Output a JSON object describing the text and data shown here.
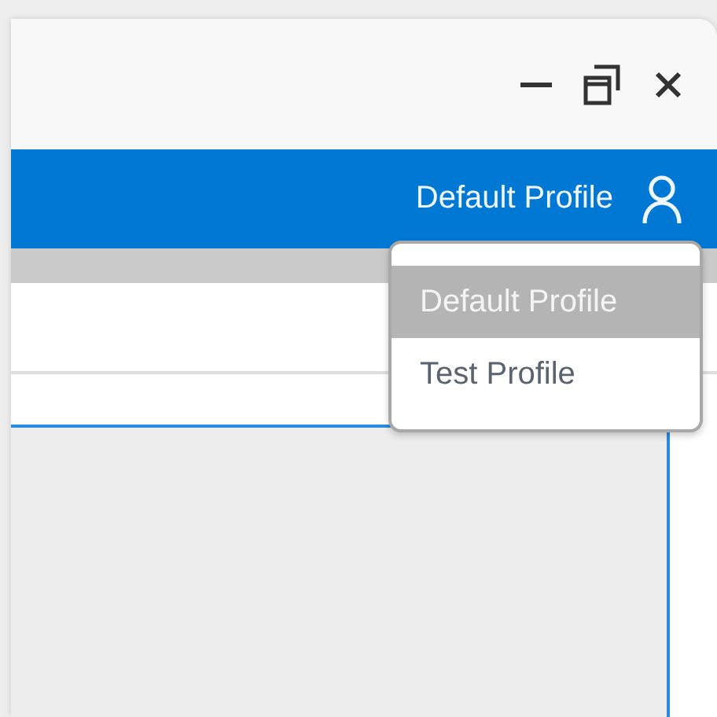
{
  "header": {
    "profile_label": "Default Profile"
  },
  "profile_menu": {
    "items": [
      {
        "label": "Default Profile",
        "selected": true
      },
      {
        "label": "Test Profile",
        "selected": false
      }
    ]
  }
}
